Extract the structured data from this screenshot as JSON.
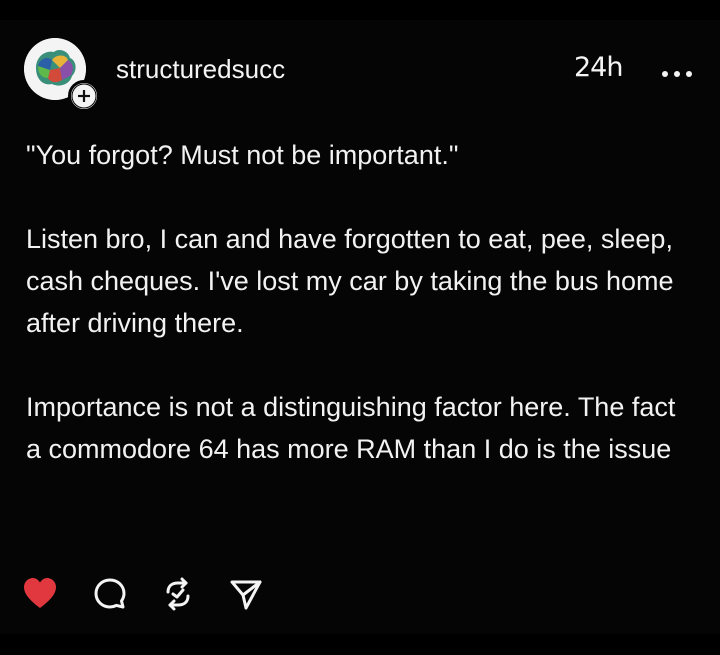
{
  "post": {
    "username": "structuredsucc",
    "time": "24h",
    "paragraphs": [
      "\"You forgot? Must not be important.\"",
      "Listen bro, I can and have forgotten to eat, pee, sleep, cash cheques. I've lost my car by taking the bus home after driving there.",
      "Importance is not a distinguishing factor here. The fact a commodore 64 has more RAM than I do is the issue"
    ]
  },
  "actions": {
    "like_icon": "heart-icon",
    "comment_icon": "comment-icon",
    "repost_icon": "repost-icon",
    "share_icon": "send-icon",
    "like_color": "#e0383e"
  }
}
